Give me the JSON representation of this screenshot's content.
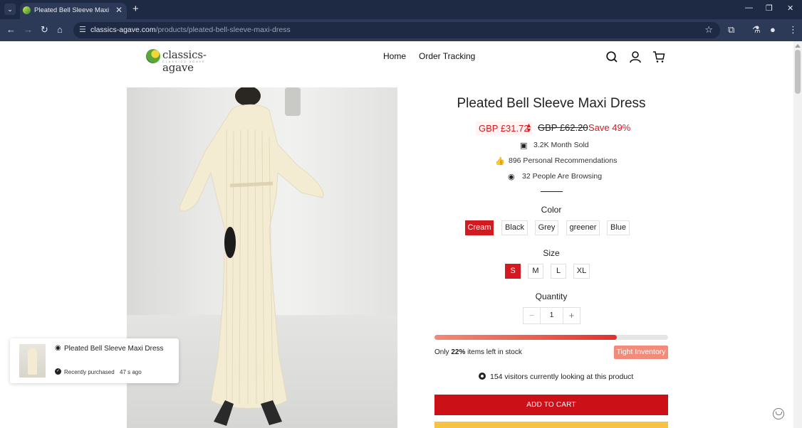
{
  "browser": {
    "tab_title": "Pleated Bell Sleeve Maxi Dress",
    "url_domain": "classics-agave.com",
    "url_path": "/products/pleated-bell-sleeve-maxi-dress",
    "new_tab_glyph": "+",
    "close_glyph": "✕"
  },
  "header": {
    "logo_text": "classics-agave",
    "logo_sub": "CLASSICS AGAVE",
    "nav": [
      {
        "label": "Home"
      },
      {
        "label": "Order Tracking"
      }
    ]
  },
  "product": {
    "title": "Pleated Bell Sleeve Maxi Dress",
    "price_now": "GBP £31.72",
    "price_old": "GBP £62.20",
    "save": "Save 49%",
    "stats": {
      "sold": "3.2K Month Sold",
      "recommendations": "896 Personal Recommendations",
      "browsing": "32 People Are Browsing"
    },
    "color_label": "Color",
    "colors": [
      {
        "label": "Cream",
        "selected": true
      },
      {
        "label": "Black",
        "selected": false
      },
      {
        "label": "Grey",
        "selected": false
      },
      {
        "label": "greener",
        "selected": false
      },
      {
        "label": "Blue",
        "selected": false
      }
    ],
    "size_label": "Size",
    "sizes": [
      {
        "label": "S",
        "selected": true
      },
      {
        "label": "M",
        "selected": false
      },
      {
        "label": "L",
        "selected": false
      },
      {
        "label": "XL",
        "selected": false
      }
    ],
    "quantity_label": "Quantity",
    "quantity": "1",
    "qty_minus": "−",
    "qty_plus": "+",
    "stock": {
      "fill_fraction": 0.78,
      "text_prefix": "Only ",
      "percent": "22%",
      "text_suffix": " items left in stock",
      "badge": "Tight Inventory"
    },
    "visitors": "154 visitors currently looking at this product",
    "add_to_cart": "ADD TO CART"
  },
  "popup": {
    "title": "Pleated Bell Sleeve Maxi Dress",
    "recent": "Recently purchased",
    "time": "47 s ago"
  },
  "colors": {
    "accent_red": "#d31a21",
    "cart_button": "#cc1018",
    "buy_button": "#f6c343",
    "badge": "#f28b7a"
  }
}
